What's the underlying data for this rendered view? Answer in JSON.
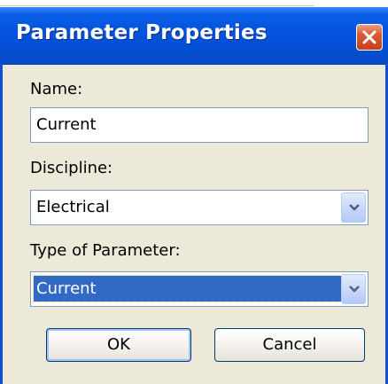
{
  "window": {
    "title": "Parameter Properties"
  },
  "form": {
    "name_label": "Name:",
    "name_value": "Current",
    "discipline_label": "Discipline:",
    "discipline_value": "Electrical",
    "type_label": "Type of Parameter:",
    "type_value": "Current"
  },
  "buttons": {
    "ok_label": "OK",
    "cancel_label": "Cancel"
  },
  "icons": {
    "close": "close-icon",
    "dropdown": "chevron-down-icon"
  },
  "colors": {
    "titlebar": "#0553e0",
    "dialog_bg": "#ece9d8",
    "close_button": "#d85a33",
    "selection": "#316ac5"
  }
}
